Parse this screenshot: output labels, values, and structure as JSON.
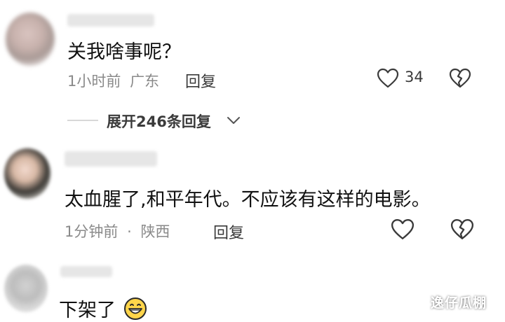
{
  "comments": [
    {
      "text": "关我啥事呢？",
      "time": "1小时前",
      "region": "广东",
      "reply_label": "回复",
      "like_count": "34"
    },
    {
      "text": "太血腥了,和平年代。不应该有这样的电影。",
      "time": "1分钟前",
      "separator": "·",
      "region": "陕西",
      "reply_label": "回复"
    },
    {
      "text": "下架了"
    }
  ],
  "expand_replies_label": "展开246条回复",
  "watermark": "逸仔瓜棚",
  "icons": {
    "like": "heart-outline-icon",
    "dislike": "broken-heart-icon",
    "expand": "chevron-down-icon",
    "emoji": "grinning-face-icon"
  },
  "colors": {
    "text": "#111111",
    "meta": "#8a8a8a",
    "icon": "#3a3a3a"
  }
}
